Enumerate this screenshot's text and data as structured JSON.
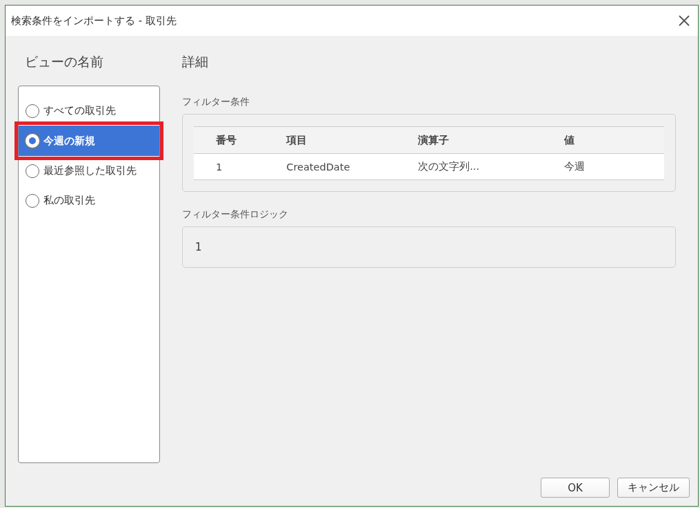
{
  "window": {
    "title": "検索条件をインポートする - 取引先"
  },
  "views": {
    "heading": "ビューの名前",
    "items": [
      {
        "label": "すべての取引先",
        "selected": false,
        "highlighted": false
      },
      {
        "label": "今週の新規",
        "selected": true,
        "highlighted": true
      },
      {
        "label": "最近参照した取引先",
        "selected": false,
        "highlighted": false
      },
      {
        "label": "私の取引先",
        "selected": false,
        "highlighted": false
      }
    ]
  },
  "details": {
    "heading": "詳細",
    "filter_label": "フィルター条件",
    "table": {
      "columns": [
        "番号",
        "項目",
        "演算子",
        "値"
      ],
      "rows": [
        [
          "1",
          "CreatedDate",
          "次の文字列...",
          "今週"
        ]
      ]
    },
    "logic_label": "フィルター条件ロジック",
    "logic_value": "1"
  },
  "buttons": [
    "OK",
    "キャンセル"
  ]
}
